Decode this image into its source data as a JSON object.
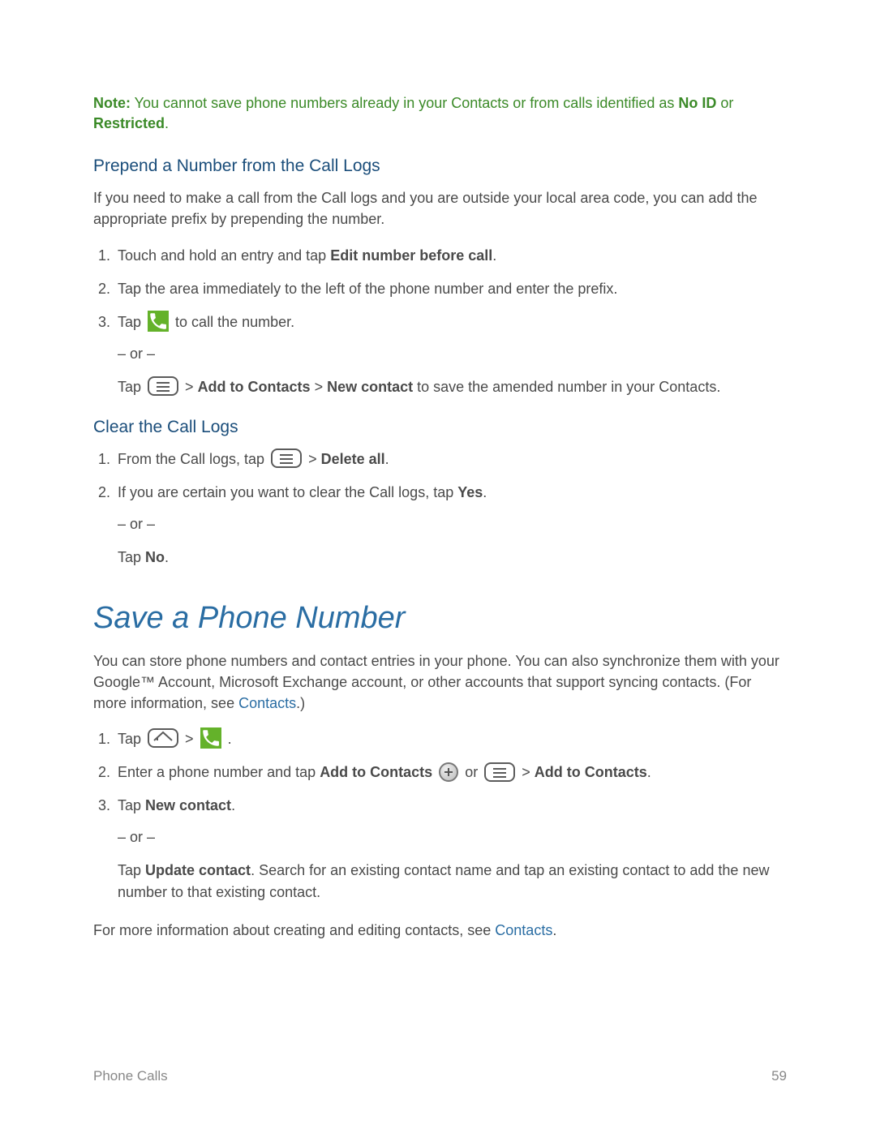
{
  "note": {
    "label": "Note:",
    "body_pre": "  You cannot save phone numbers already in your Contacts or from calls identified as ",
    "noid": "No ID",
    "or": " or ",
    "restricted": "Restricted",
    "dot": "."
  },
  "prepend": {
    "heading": "Prepend a Number from the Call Logs",
    "intro": "If you need to make a call from the Call logs and you are outside your local area code, you can add the appropriate prefix by prepending the number.",
    "s1_pre": "Touch and hold an entry and tap ",
    "s1_bold": "Edit number before call",
    "s1_post": ".",
    "s2": "Tap the area immediately to the left of the phone number and enter the prefix.",
    "s3_pre": "Tap ",
    "s3_post": " to call the number.",
    "or": "– or –",
    "s3b_pre": "Tap ",
    "s3b_gt1": " > ",
    "s3b_add": "Add to Contacts",
    "s3b_gt2": " > ",
    "s3b_new": "New contact",
    "s3b_post": " to save the amended number in your Contacts."
  },
  "clear": {
    "heading": "Clear the Call Logs",
    "s1_pre": "From the Call logs, tap ",
    "s1_gt": " > ",
    "s1_del": "Delete all",
    "s1_post": ".",
    "s2_pre": "If you are certain you want to clear the Call logs, tap ",
    "s2_yes": "Yes",
    "s2_post": ".",
    "or": "– or –",
    "s2b_pre": "Tap ",
    "s2b_no": "No",
    "s2b_post": "."
  },
  "save": {
    "title": "Save a Phone Number",
    "intro_pre": "You can store phone numbers and contact entries in your phone. You can also synchronize them with your Google™ Account, Microsoft Exchange account, or other accounts that support syncing contacts. (For more information, see ",
    "intro_link": "Contacts",
    "intro_post": ".)",
    "s1_pre": "Tap ",
    "s1_gt": " > ",
    "s1_post": ".",
    "s2_pre": "Enter a phone number and tap ",
    "s2_addc": "Add to Contacts",
    "s2_or": " or ",
    "s2_gt": " > ",
    "s2_addc2": "Add to Contacts",
    "s2_post": ".",
    "s3_pre": "Tap ",
    "s3_new": "New contact",
    "s3_post": ".",
    "or": "– or –",
    "s3b_pre": "Tap ",
    "s3b_upd": "Update contact",
    "s3b_post": ". Search for an existing contact name and tap an existing contact to add the new number to that existing contact.",
    "outro_pre": "For more information about creating and editing contacts, see ",
    "outro_link": "Contacts",
    "outro_post": "."
  },
  "footer": {
    "left": "Phone Calls",
    "right": "59"
  }
}
